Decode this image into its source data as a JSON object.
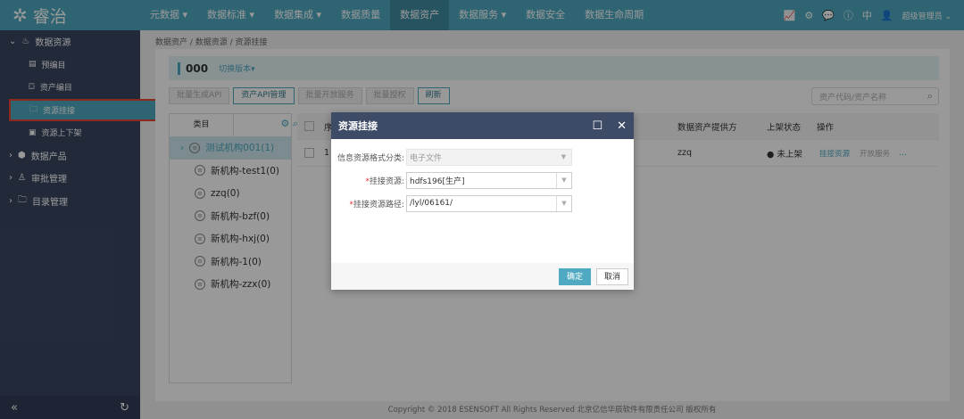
{
  "app": {
    "logo": "睿治"
  },
  "nav": [
    {
      "label": "元数据 ▾"
    },
    {
      "label": "数据标准 ▾"
    },
    {
      "label": "数据集成 ▾"
    },
    {
      "label": "数据质量"
    },
    {
      "label": "数据资产"
    },
    {
      "label": "数据服务 ▾"
    },
    {
      "label": "数据安全"
    },
    {
      "label": "数据生命周期"
    }
  ],
  "tools": {
    "lang": "中",
    "user": "超级管理员 ⌄"
  },
  "sidebar": {
    "group": "数据资源",
    "items": [
      {
        "label": "预编目"
      },
      {
        "label": "资产编目"
      },
      {
        "label": "资源挂接"
      },
      {
        "label": "资源上下架"
      }
    ],
    "others": [
      {
        "label": "数据产品"
      },
      {
        "label": "审批管理"
      },
      {
        "label": "目录管理"
      }
    ]
  },
  "breadcrumb": "数据资产 / 数据资源 / 资源挂接",
  "version": {
    "name": "000",
    "switch": "切换版本▾"
  },
  "toolbar": {
    "b1": "批量生成API",
    "b2": "资产API管理",
    "b3": "批量开放服务",
    "b4": "批量授权",
    "b5": "刷新",
    "search_placeholder": "资产代码/资产名称"
  },
  "tree": {
    "tab": "类目",
    "nodes": [
      {
        "label": "测试机构001(1)"
      },
      {
        "label": "新机构-test1(0)"
      },
      {
        "label": "zzq(0)"
      },
      {
        "label": "新机构-bzf(0)"
      },
      {
        "label": "新机构-hxj(0)"
      },
      {
        "label": "新机构-1(0)"
      },
      {
        "label": "新机构-zzx(0)"
      }
    ]
  },
  "table": {
    "headers": {
      "seq": "序",
      "provider": "数据资产提供方",
      "status": "上架状态",
      "ops": "操作"
    },
    "row": {
      "seq": "1",
      "provider": "zzq",
      "status": "未上架",
      "op1": "挂接资源",
      "op2": "开放服务",
      "more": "..."
    }
  },
  "modal": {
    "title": "资源挂接",
    "f1_label": "信息资源格式分类:",
    "f1_value": "电子文件",
    "f2_label": "挂接资源:",
    "f2_value": "hdfs196[生产]",
    "f3_label": "挂接资源路径:",
    "f3_value": "/lyl/06161/",
    "ok": "确定",
    "cancel": "取消"
  },
  "footer": "Copyright © 2018 ESENSOFT All Rights Reserved 北京亿信华辰软件有限责任公司 版权所有"
}
